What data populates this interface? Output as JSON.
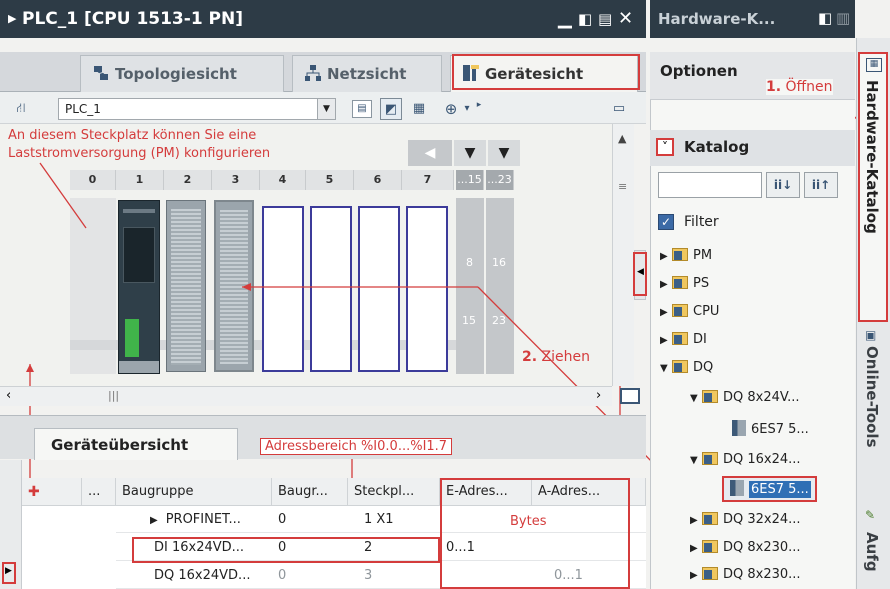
{
  "window": {
    "title": "PLC_1 [CPU 1513-1 PN]"
  },
  "catalog_window": {
    "title": "Hardware-K..."
  },
  "view_tabs": [
    {
      "label": "Topologiesicht"
    },
    {
      "label": "Netzsicht"
    },
    {
      "label": "Gerätesicht"
    }
  ],
  "toolbar": {
    "device_select": "PLC_1"
  },
  "rack": {
    "annotation": "An diesem Steckplatz können Sie eine\nLaststromversorgung (PM) konfigurieren",
    "slots": [
      "0",
      "1",
      "2",
      "3",
      "4",
      "5",
      "6",
      "7"
    ],
    "extra_slot_labels": [
      "...15",
      "...23"
    ],
    "overlay_numbers": [
      "8",
      "16",
      "15",
      "23"
    ],
    "drag_label_num": "2.",
    "drag_label": " Ziehen"
  },
  "overview": {
    "tab": "Geräteübersicht",
    "address_annotation": "Adressbereich %I0.0...%I1.7",
    "bytes_annotation": "Bytes",
    "columns": [
      "...",
      "Baugruppe",
      "Baugr...",
      "Steckpl...",
      "E-Adres...",
      "A-Adres..."
    ],
    "rows": [
      {
        "name": "PROFINET...",
        "rack": "0",
        "slot": "1 X1",
        "e_addr": "",
        "a_addr": ""
      },
      {
        "name": "DI 16x24VD...",
        "rack": "0",
        "slot": "2",
        "e_addr": "0...1",
        "a_addr": ""
      },
      {
        "name": "DQ 16x24VD...",
        "rack": "0",
        "slot": "3",
        "e_addr": "",
        "a_addr": "0...1"
      }
    ]
  },
  "catalog": {
    "options_label": "Optionen",
    "open_num": "1.",
    "open_label": " Öffnen",
    "catalog_label": "Katalog",
    "filter_label": "Filter",
    "tree": [
      {
        "label": "PM"
      },
      {
        "label": "PS"
      },
      {
        "label": "CPU"
      },
      {
        "label": "DI"
      },
      {
        "label": "DQ"
      },
      {
        "label": "DQ 8x24V..."
      },
      {
        "label": "6ES7 5..."
      },
      {
        "label": "DQ 16x24..."
      },
      {
        "label": "6ES7 5..."
      },
      {
        "label": "DQ 32x24..."
      },
      {
        "label": "DQ 8x230..."
      },
      {
        "label": "DQ 8x230..."
      }
    ]
  },
  "side_tabs": [
    "Hardware-Katalog",
    "Online-Tools",
    "Aufg"
  ],
  "colors": {
    "titlebar": "#2d3b46",
    "annotation_red": "#d43c3c",
    "module_frame": "#3c3b9a"
  }
}
